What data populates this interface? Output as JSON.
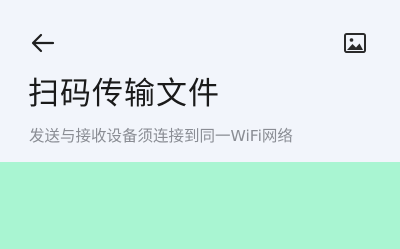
{
  "header": {
    "back_icon": "arrow-left-icon",
    "gallery_icon": "image-icon",
    "title": "扫码传输文件",
    "subtitle": "发送与接收设备须连接到同一WiFi网络"
  },
  "colors": {
    "header_background": "#f2f5fb",
    "content_background": "#a9f5d2",
    "title_text": "#1a1a1a",
    "subtitle_text": "#8a8d94"
  }
}
